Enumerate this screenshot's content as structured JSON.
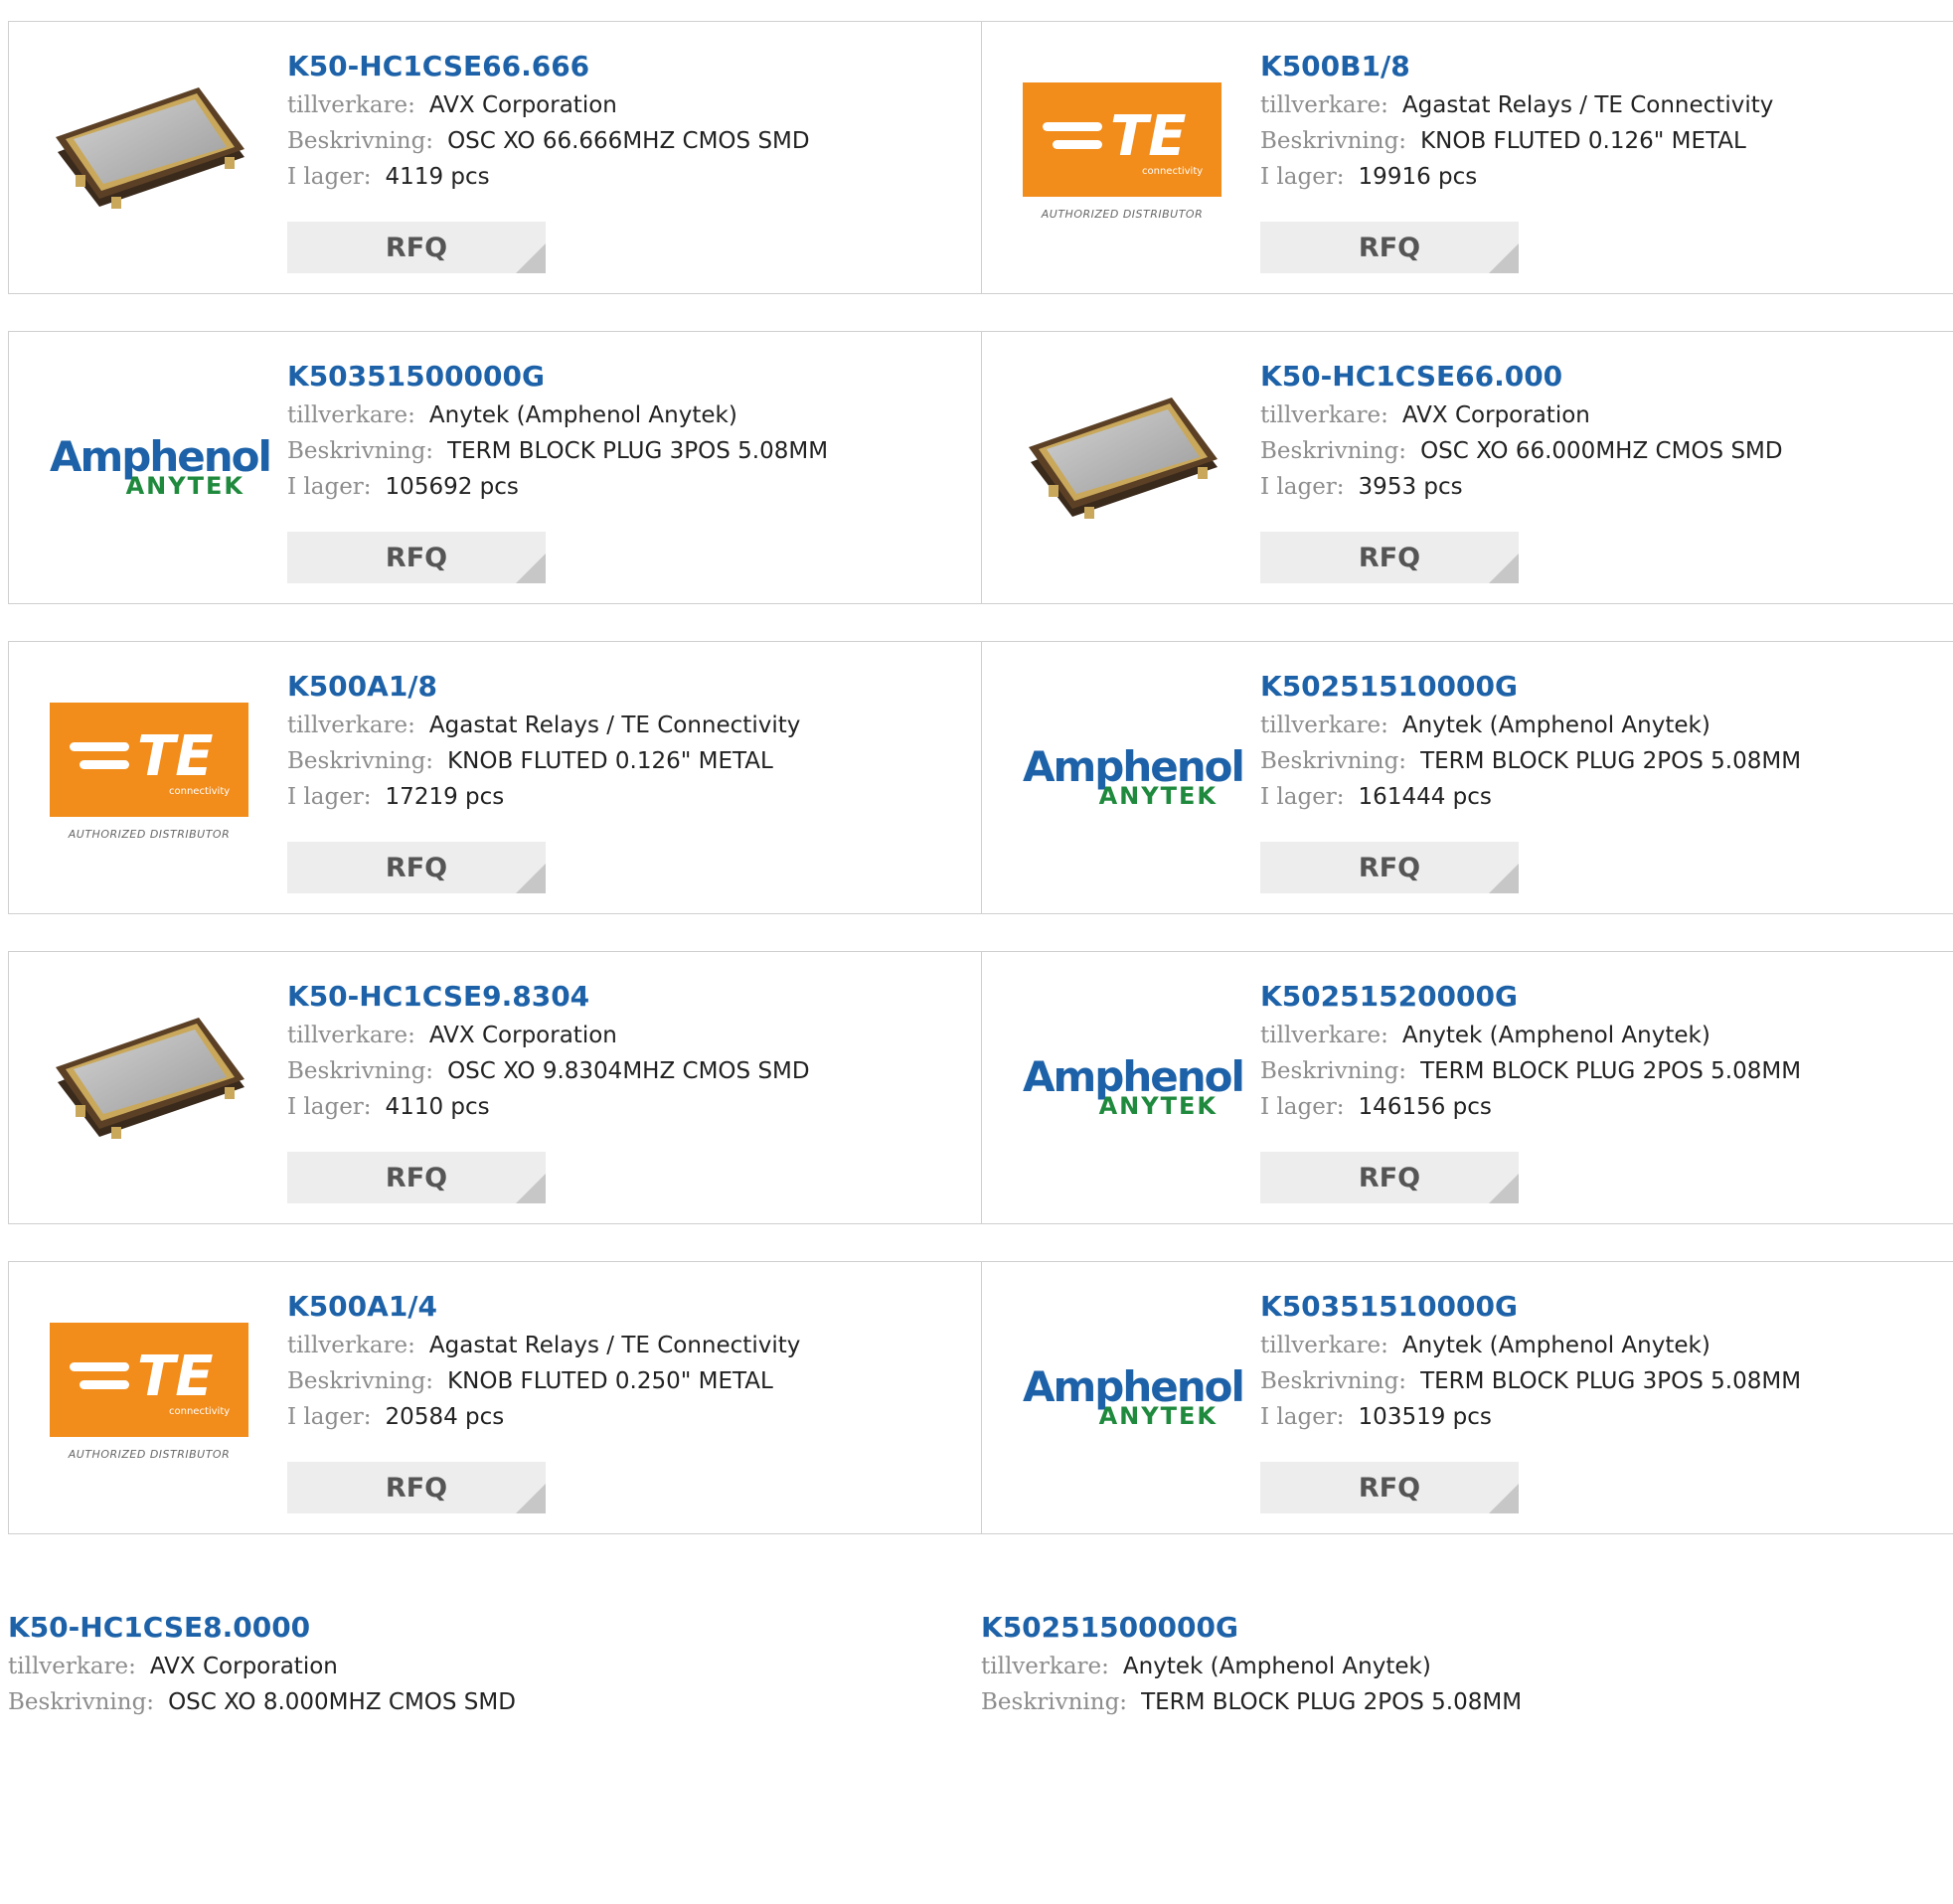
{
  "labels": {
    "manufacturer": "tillverkare:",
    "description": "Beskrivning:",
    "stock": "I lager:",
    "rfq": "RFQ"
  },
  "logo_text": {
    "te_main": "TE",
    "te_sub": "connectivity",
    "te_tagline": "AUTHORIZED DISTRIBUTOR",
    "amphenol_main": "Amphenol",
    "amphenol_sub": "ANYTEK"
  },
  "colors": {
    "link": "#1d62a8",
    "te_orange": "#f28c1a",
    "amphenol_blue": "#1d62a8",
    "amphenol_green": "#1f8a3d"
  },
  "products": [
    {
      "part": "K50-HC1CSE66.666",
      "manufacturer": "AVX Corporation",
      "description": "OSC XO 66.666MHZ CMOS SMD",
      "stock": "4119 pcs",
      "image": "oscillator-icon"
    },
    {
      "part": "K500B1/8",
      "manufacturer": "Agastat Relays / TE Connectivity",
      "description": "KNOB FLUTED 0.126\" METAL",
      "stock": "19916 pcs",
      "image": "te-logo"
    },
    {
      "part": "K50351500000G",
      "manufacturer": "Anytek (Amphenol Anytek)",
      "description": "TERM BLOCK PLUG 3POS 5.08MM",
      "stock": "105692 pcs",
      "image": "amphenol-logo"
    },
    {
      "part": "K50-HC1CSE66.000",
      "manufacturer": "AVX Corporation",
      "description": "OSC XO 66.000MHZ CMOS SMD",
      "stock": "3953 pcs",
      "image": "oscillator-icon"
    },
    {
      "part": "K500A1/8",
      "manufacturer": "Agastat Relays / TE Connectivity",
      "description": "KNOB FLUTED 0.126\" METAL",
      "stock": "17219 pcs",
      "image": "te-logo"
    },
    {
      "part": "K50251510000G",
      "manufacturer": "Anytek (Amphenol Anytek)",
      "description": "TERM BLOCK PLUG 2POS 5.08MM",
      "stock": "161444 pcs",
      "image": "amphenol-logo"
    },
    {
      "part": "K50-HC1CSE9.8304",
      "manufacturer": "AVX Corporation",
      "description": "OSC XO 9.8304MHZ CMOS SMD",
      "stock": "4110 pcs",
      "image": "oscillator-icon"
    },
    {
      "part": "K50251520000G",
      "manufacturer": "Anytek (Amphenol Anytek)",
      "description": "TERM BLOCK PLUG 2POS 5.08MM",
      "stock": "146156 pcs",
      "image": "amphenol-logo"
    },
    {
      "part": "K500A1/4",
      "manufacturer": "Agastat Relays / TE Connectivity",
      "description": "KNOB FLUTED 0.250\" METAL",
      "stock": "20584 pcs",
      "image": "te-logo"
    },
    {
      "part": "K50351510000G",
      "manufacturer": "Anytek (Amphenol Anytek)",
      "description": "TERM BLOCK PLUG 3POS 5.08MM",
      "stock": "103519 pcs",
      "image": "amphenol-logo"
    },
    {
      "part": "K50-HC1CSE8.0000",
      "manufacturer": "AVX Corporation",
      "description": "OSC XO 8.000MHZ CMOS SMD",
      "image": "none"
    },
    {
      "part": "K50251500000G",
      "manufacturer": "Anytek (Amphenol Anytek)",
      "description": "TERM BLOCK PLUG 2POS 5.08MM",
      "image": "none"
    }
  ]
}
